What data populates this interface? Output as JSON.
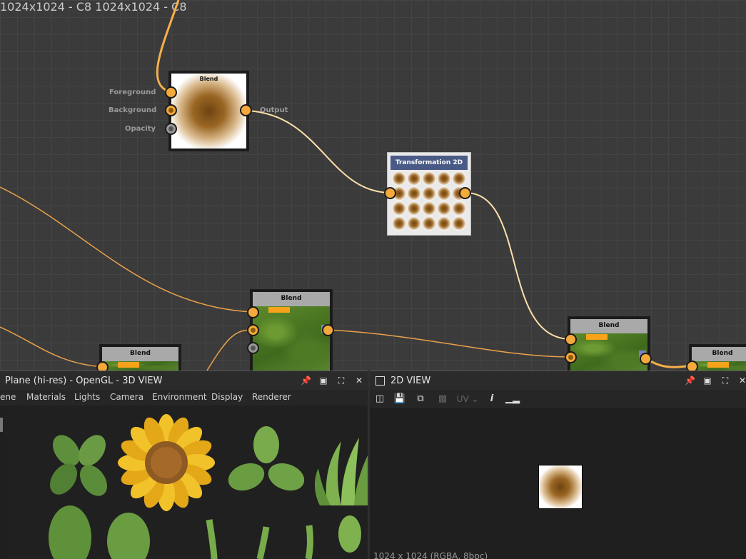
{
  "graph": {
    "blend_top": {
      "title": "Blend",
      "resolution": "1024x1024 - C8",
      "inputs": [
        "Foreground",
        "Background",
        "Opacity"
      ],
      "output": "Output"
    },
    "transform": {
      "title": "Transformation 2D",
      "resolution": "1024x1024 - C8"
    },
    "blend_mid": {
      "title": "Blend"
    },
    "blend_right": {
      "title": "Blend"
    },
    "blend_far_right": {
      "title": "Blend"
    },
    "blend_left": {
      "title": "Blend"
    }
  },
  "view3d": {
    "title": "Plane (hi-res) - OpenGL - 3D VIEW",
    "menu": [
      "ene",
      "Materials",
      "Lights",
      "Camera",
      "Environment",
      "Display",
      "Renderer"
    ]
  },
  "view2d": {
    "title": "2D VIEW",
    "uv_label": "UV",
    "status": "1024 x 1024 (RGBA, 8bpc)"
  },
  "colors": {
    "wire": "#f6b04a",
    "wire_light": "#fde0a8",
    "port": "#f4a93a",
    "panel_bg": "#1f1f1f"
  }
}
